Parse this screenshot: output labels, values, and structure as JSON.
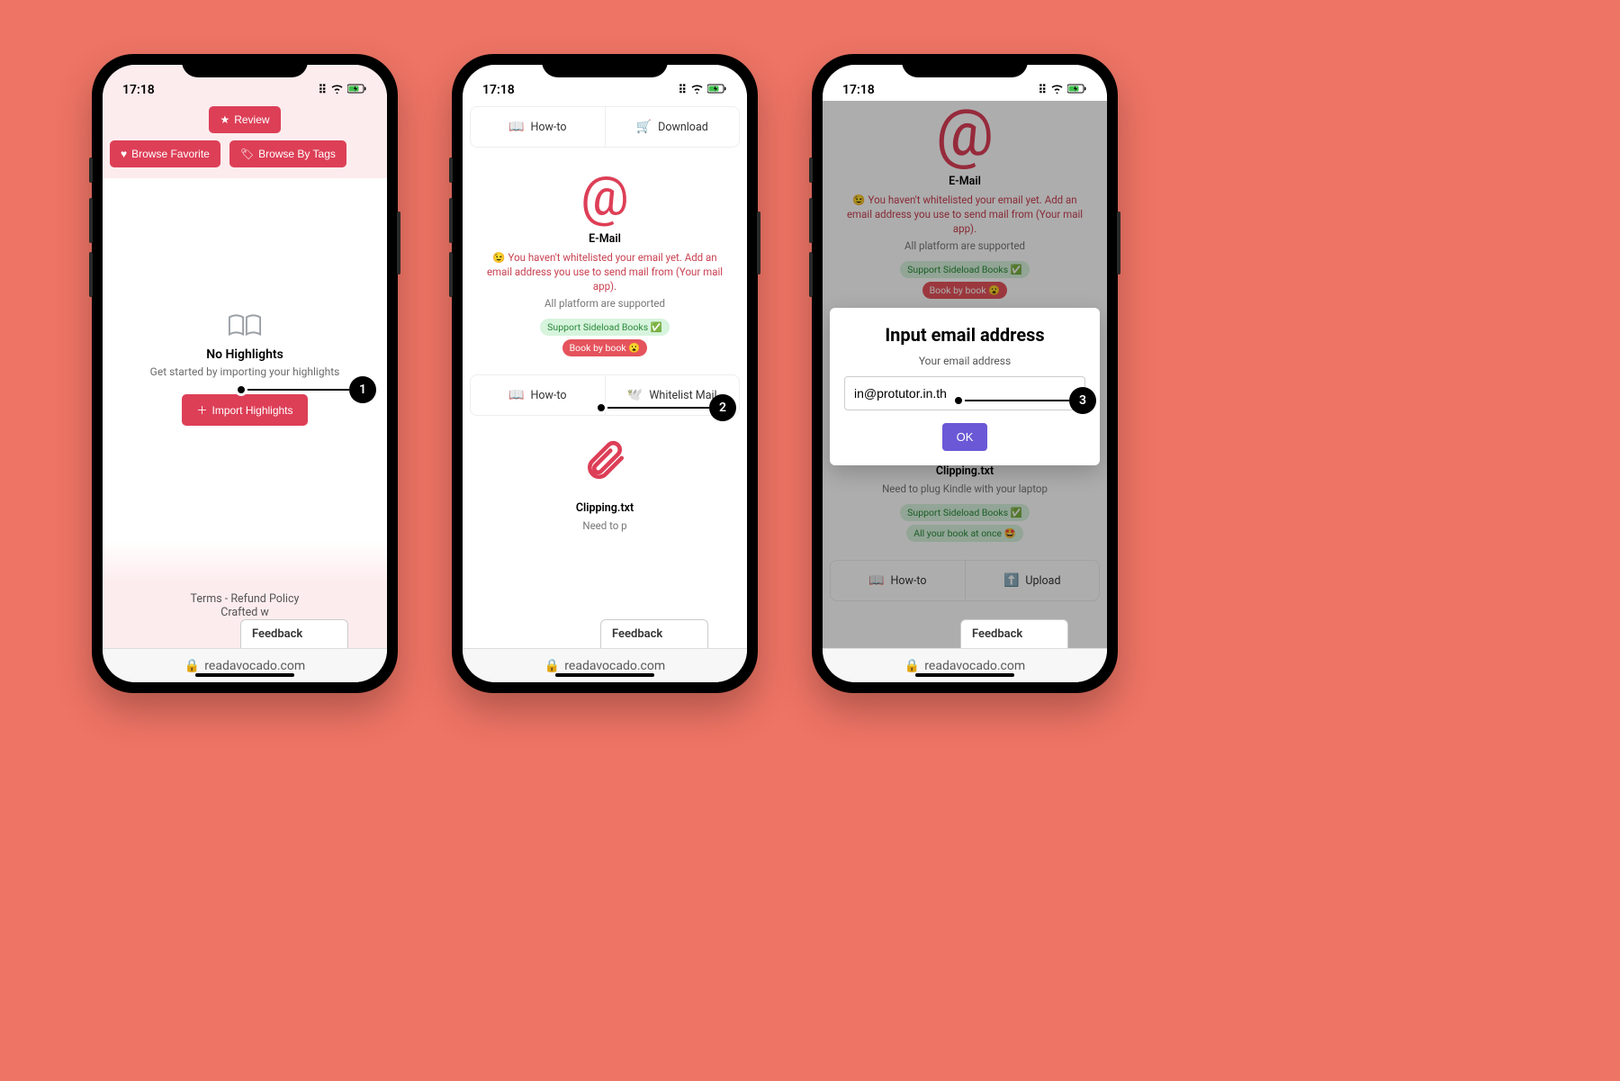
{
  "status": {
    "time": "17:18"
  },
  "url": "readavocado.com",
  "feedback": "Feedback",
  "screen1": {
    "review": "Review",
    "browse_fav": "Browse Favorite",
    "browse_tags": "Browse By Tags",
    "no_hl_title": "No Highlights",
    "no_hl_sub": "Get started by importing your highlights",
    "import_btn": "Import Highlights",
    "terms": "Terms - Refund Policy",
    "crafted": "Crafted w"
  },
  "screen2": {
    "howto": "How-to",
    "download": "Download",
    "whitelist": "Whitelist Mail",
    "email_title": "E-Mail",
    "email_warn": "😉 You haven't whitelisted your email yet. Add an email address you use to send mail from (Your mail app).",
    "email_platform": "All platform are supported",
    "badge_sideload": "Support Sideload Books ✅",
    "badge_book": "Book by book 😮",
    "clip_title": "Clipping.txt",
    "clip_sub": "Need to p"
  },
  "screen3": {
    "email_title": "E-Mail",
    "email_warn": "😉 You haven't whitelisted your email yet. Add an email address you use to send mail from (Your mail app).",
    "email_platform": "All platform are supported",
    "badge_sideload": "Support Sideload Books ✅",
    "badge_book": "Book by book 😮",
    "clip_title": "Clipping.txt",
    "clip_sub": "Need to plug Kindle with your laptop",
    "badge_all": "All your book at once 🤩",
    "howto": "How-to",
    "upload": "Upload",
    "modal_title": "Input email address",
    "modal_label": "Your email address",
    "modal_value": "in@protutor.in.th",
    "modal_ok": "OK"
  },
  "callouts": {
    "c1": "1",
    "c2": "2",
    "c3": "3"
  }
}
